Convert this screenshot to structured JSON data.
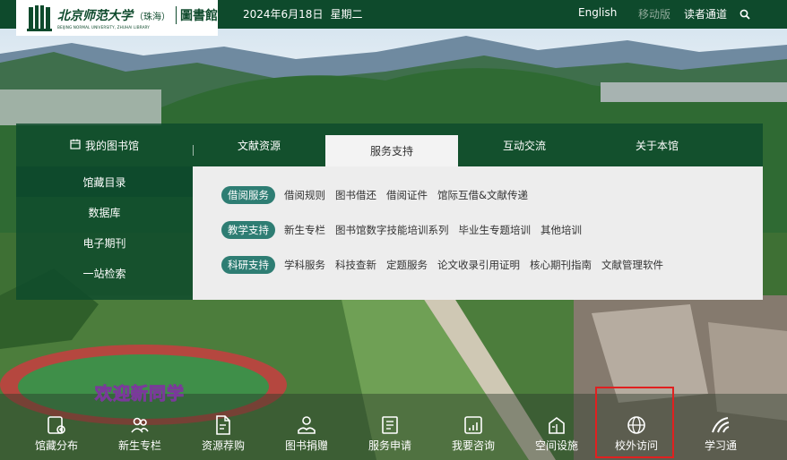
{
  "header": {
    "logo": {
      "university": "北京师范大学",
      "campus": "（珠海）",
      "library": "圖書館",
      "english": "BEIJING NORMAL UNIVERSITY, ZHUHAI  LIBRARY"
    },
    "date": "2024年6月18日",
    "weekday": "星期二",
    "links": {
      "english": "English",
      "mobile": "移动版",
      "reader": "读者通道"
    },
    "search_icon": "search-icon"
  },
  "tabs": [
    {
      "label": "我的图书馆",
      "icon": "calendar-icon"
    },
    {
      "label": "文献资源"
    },
    {
      "label": "服务支持",
      "active": true
    },
    {
      "label": "互动交流"
    },
    {
      "label": "关于本馆"
    }
  ],
  "left_menu": [
    "馆藏目录",
    "数据库",
    "电子期刊",
    "一站检索"
  ],
  "service_rows": [
    {
      "category": "借阅服务",
      "links": [
        "借阅规则",
        "图书借还",
        "借阅证件",
        "馆际互借&文献传递"
      ]
    },
    {
      "category": "教学支持",
      "links": [
        "新生专栏",
        "图书馆数字技能培训系列",
        "毕业生专题培训",
        "其他培训"
      ]
    },
    {
      "category": "科研支持",
      "links": [
        "学科服务",
        "科技查新",
        "定题服务",
        "论文收录引用证明",
        "核心期刊指南",
        "文献管理软件"
      ]
    }
  ],
  "banner_text": "欢迎新同学",
  "bottom_nav": [
    {
      "label": "馆藏分布",
      "icon": "collection-icon"
    },
    {
      "label": "新生专栏",
      "icon": "users-icon"
    },
    {
      "label": "资源荐购",
      "icon": "document-icon"
    },
    {
      "label": "图书捐赠",
      "icon": "donate-icon"
    },
    {
      "label": "服务申请",
      "icon": "book-icon"
    },
    {
      "label": "我要咨询",
      "icon": "consult-icon"
    },
    {
      "label": "空间设施",
      "icon": "building-icon"
    },
    {
      "label": "校外访问",
      "icon": "globe-icon",
      "highlighted": true
    },
    {
      "label": "学习通",
      "icon": "xuexitong-icon"
    }
  ],
  "colors": {
    "brand": "#0e4a2c",
    "badge": "#2e7d73",
    "highlight": "#e02020"
  }
}
